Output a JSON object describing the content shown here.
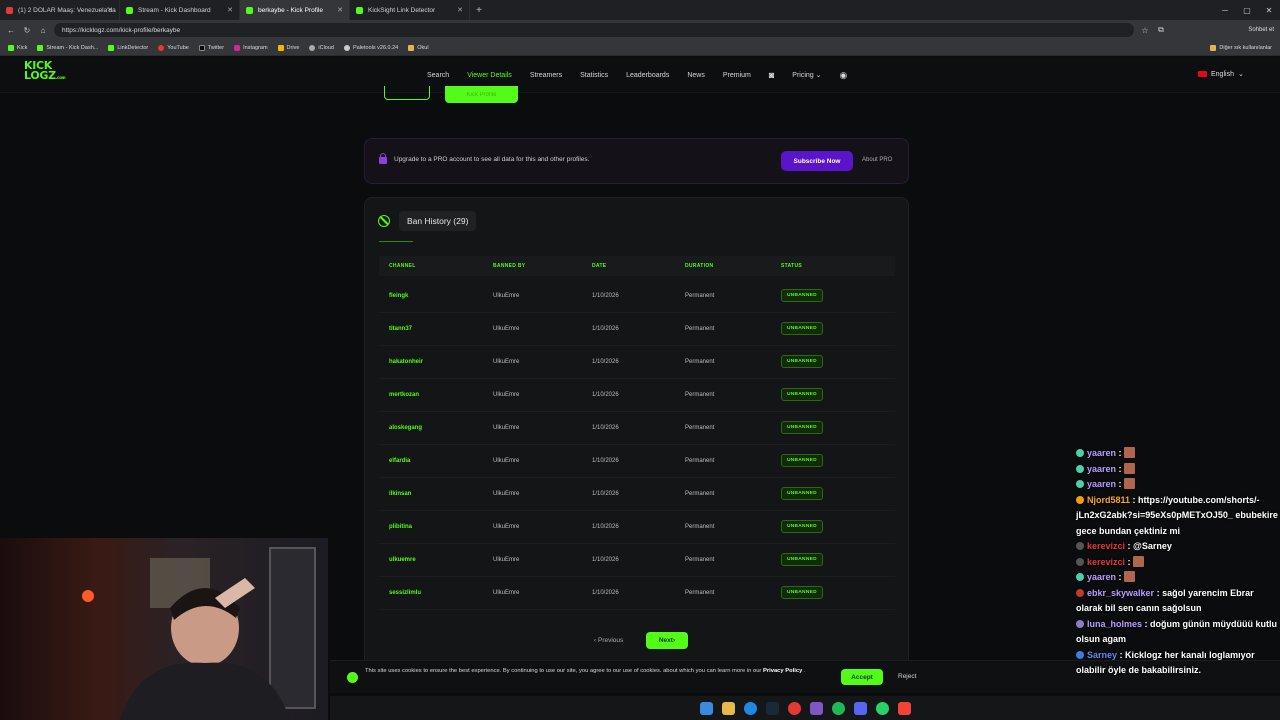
{
  "browser": {
    "tabs": [
      {
        "label": "(1) 2 DOLAR Maaş: Venezuela'da",
        "color": "#e53935"
      },
      {
        "label": "Stream - Kick Dashboard",
        "color": "#53fc18"
      },
      {
        "label": "berkaybe - Kick Profile",
        "color": "#53fc18"
      },
      {
        "label": "KickSight Link Detector",
        "color": "#53fc18"
      }
    ],
    "url": "https://kicklogz.com/kick-profile/berkaybe",
    "bookmarks": [
      "Kick",
      "Stream - Kick Dash...",
      "LinkDetector",
      "YouTube",
      "Twitter",
      "Instagram",
      "Drive",
      "iCloud",
      "Paletools v26.0.24",
      "Okul"
    ],
    "bookmarks_right": "Diğer sık kullanılanlar",
    "profile_chip": "Sohbet et"
  },
  "site": {
    "logo_line1": "KICK",
    "logo_line2": "LOGZ",
    "logo_suffix": ".com",
    "nav": [
      "Search",
      "Viewer Details",
      "Streamers",
      "Statistics",
      "Leaderboards",
      "News",
      "Premium",
      "Pricing"
    ],
    "active_nav": "Viewer Details",
    "language": "English",
    "top_button": "Kick Profile"
  },
  "pro_banner": {
    "text": "Upgrade to a PRO account to see all data for this and other profiles.",
    "subscribe": "Subscribe Now",
    "about": "About PRO"
  },
  "ban_history": {
    "title": "Ban History (29)",
    "columns": [
      "CHANNEL",
      "BANNED BY",
      "DATE",
      "DURATION",
      "STATUS"
    ],
    "rows": [
      {
        "channel": "fleingk",
        "banned_by": "UlkuEmre",
        "date": "1/10/2026",
        "duration": "Permanent",
        "status": "UNBANNED"
      },
      {
        "channel": "titann37",
        "banned_by": "UlkuEmre",
        "date": "1/10/2026",
        "duration": "Permanent",
        "status": "UNBANNED"
      },
      {
        "channel": "hakatonheir",
        "banned_by": "UlkuEmre",
        "date": "1/10/2026",
        "duration": "Permanent",
        "status": "UNBANNED"
      },
      {
        "channel": "mertkozan",
        "banned_by": "UlkuEmre",
        "date": "1/10/2026",
        "duration": "Permanent",
        "status": "UNBANNED"
      },
      {
        "channel": "aloskegang",
        "banned_by": "UlkuEmre",
        "date": "1/10/2026",
        "duration": "Permanent",
        "status": "UNBANNED"
      },
      {
        "channel": "elfardia",
        "banned_by": "UlkuEmre",
        "date": "1/10/2026",
        "duration": "Permanent",
        "status": "UNBANNED"
      },
      {
        "channel": "ilkinsan",
        "banned_by": "UlkuEmre",
        "date": "1/10/2026",
        "duration": "Permanent",
        "status": "UNBANNED"
      },
      {
        "channel": "plibitina",
        "banned_by": "UlkuEmre",
        "date": "1/10/2026",
        "duration": "Permanent",
        "status": "UNBANNED"
      },
      {
        "channel": "ulkuemre",
        "banned_by": "UlkuEmre",
        "date": "1/10/2026",
        "duration": "Permanent",
        "status": "UNBANNED"
      },
      {
        "channel": "sessizlimlu",
        "banned_by": "UlkuEmre",
        "date": "1/10/2026",
        "duration": "Permanent",
        "status": "UNBANNED"
      }
    ],
    "previous": "Previous",
    "next": "Next"
  },
  "cookie": {
    "text": "This site uses cookies to ensure the best experience. By continuing to use our site, you agree to our use of cookies. about which you can learn more in our",
    "link": "Privacy Policy",
    "accept": "Accept",
    "reject": "Reject"
  },
  "chat": [
    {
      "user": "yaaren",
      "msg": ":",
      "emote": true,
      "style": "purple"
    },
    {
      "user": "yaaren",
      "msg": ":",
      "emote": true,
      "style": "purple"
    },
    {
      "user": "yaaren",
      "msg": ":",
      "emote": true,
      "style": "purple"
    },
    {
      "user": "Njord5811",
      "msg": ": https://youtube.com/shorts/-jLn2xG2abk?si=95eXs0pMETxOJ50_ ebubekire gece bundan çektiniz mi",
      "emote": false,
      "style": "orange"
    },
    {
      "user": "kerevizci",
      "msg": ": @Sarney",
      "emote": false,
      "style": "red"
    },
    {
      "user": "kerevizci",
      "msg": ":",
      "emote": true,
      "style": "red"
    },
    {
      "user": "yaaren",
      "msg": ":",
      "emote": true,
      "style": "purple"
    },
    {
      "user": "ebkr_skywalker",
      "msg": ": sağol yarencim Ebrar olarak bil sen canın sağolsun",
      "emote": false,
      "style": "purple"
    },
    {
      "user": "luna_holmes",
      "msg": ": doğum günün müydüüü kutlu olsun agam",
      "emote": false,
      "style": "purple"
    },
    {
      "user": "Sarney",
      "msg": ": Kicklogz her kanalı loglamıyor olabilir öyle de bakabilirsiniz.",
      "emote": false,
      "style": "blue"
    }
  ]
}
